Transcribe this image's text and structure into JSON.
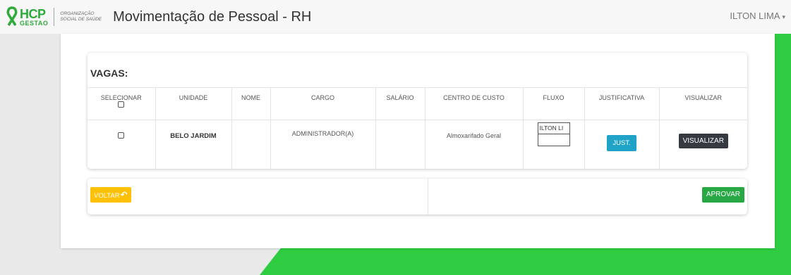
{
  "header": {
    "logo_hcp": "HCP",
    "logo_gestao": "GESTAO",
    "logo_org_line1": "ORGANIZAÇÃO",
    "logo_org_line2": "SOCIAL DE SAÚDE",
    "title": "Movimentação de Pessoal - RH",
    "user": "ILTON LIMA"
  },
  "vagas": {
    "title": "VAGAS:",
    "columns": [
      "SELECIONAR",
      "UNIDADE",
      "NOME",
      "CARGO",
      "SALÁRIO",
      "CENTRO DE CUSTO",
      "FLUXO",
      "JUSTIFICATIVA",
      "VISUALIZAR"
    ],
    "rows": [
      {
        "unidade": "BELO JARDIM",
        "nome": "",
        "cargo": "ADMINISTRADOR(A)",
        "salario": "",
        "centro_custo": "Almoxarifado Geral",
        "fluxo": "ILTON LI",
        "just_label": "JUST.",
        "visualizar_label": "VISUALIZAR"
      }
    ]
  },
  "actions": {
    "voltar": "VOLTAR",
    "aprovar": "APROVAR"
  },
  "colors": {
    "green": "#2ecc40",
    "just": "#1fa3c6",
    "visualizar": "#343a40",
    "voltar": "#ffc107",
    "aprovar": "#28a745"
  }
}
